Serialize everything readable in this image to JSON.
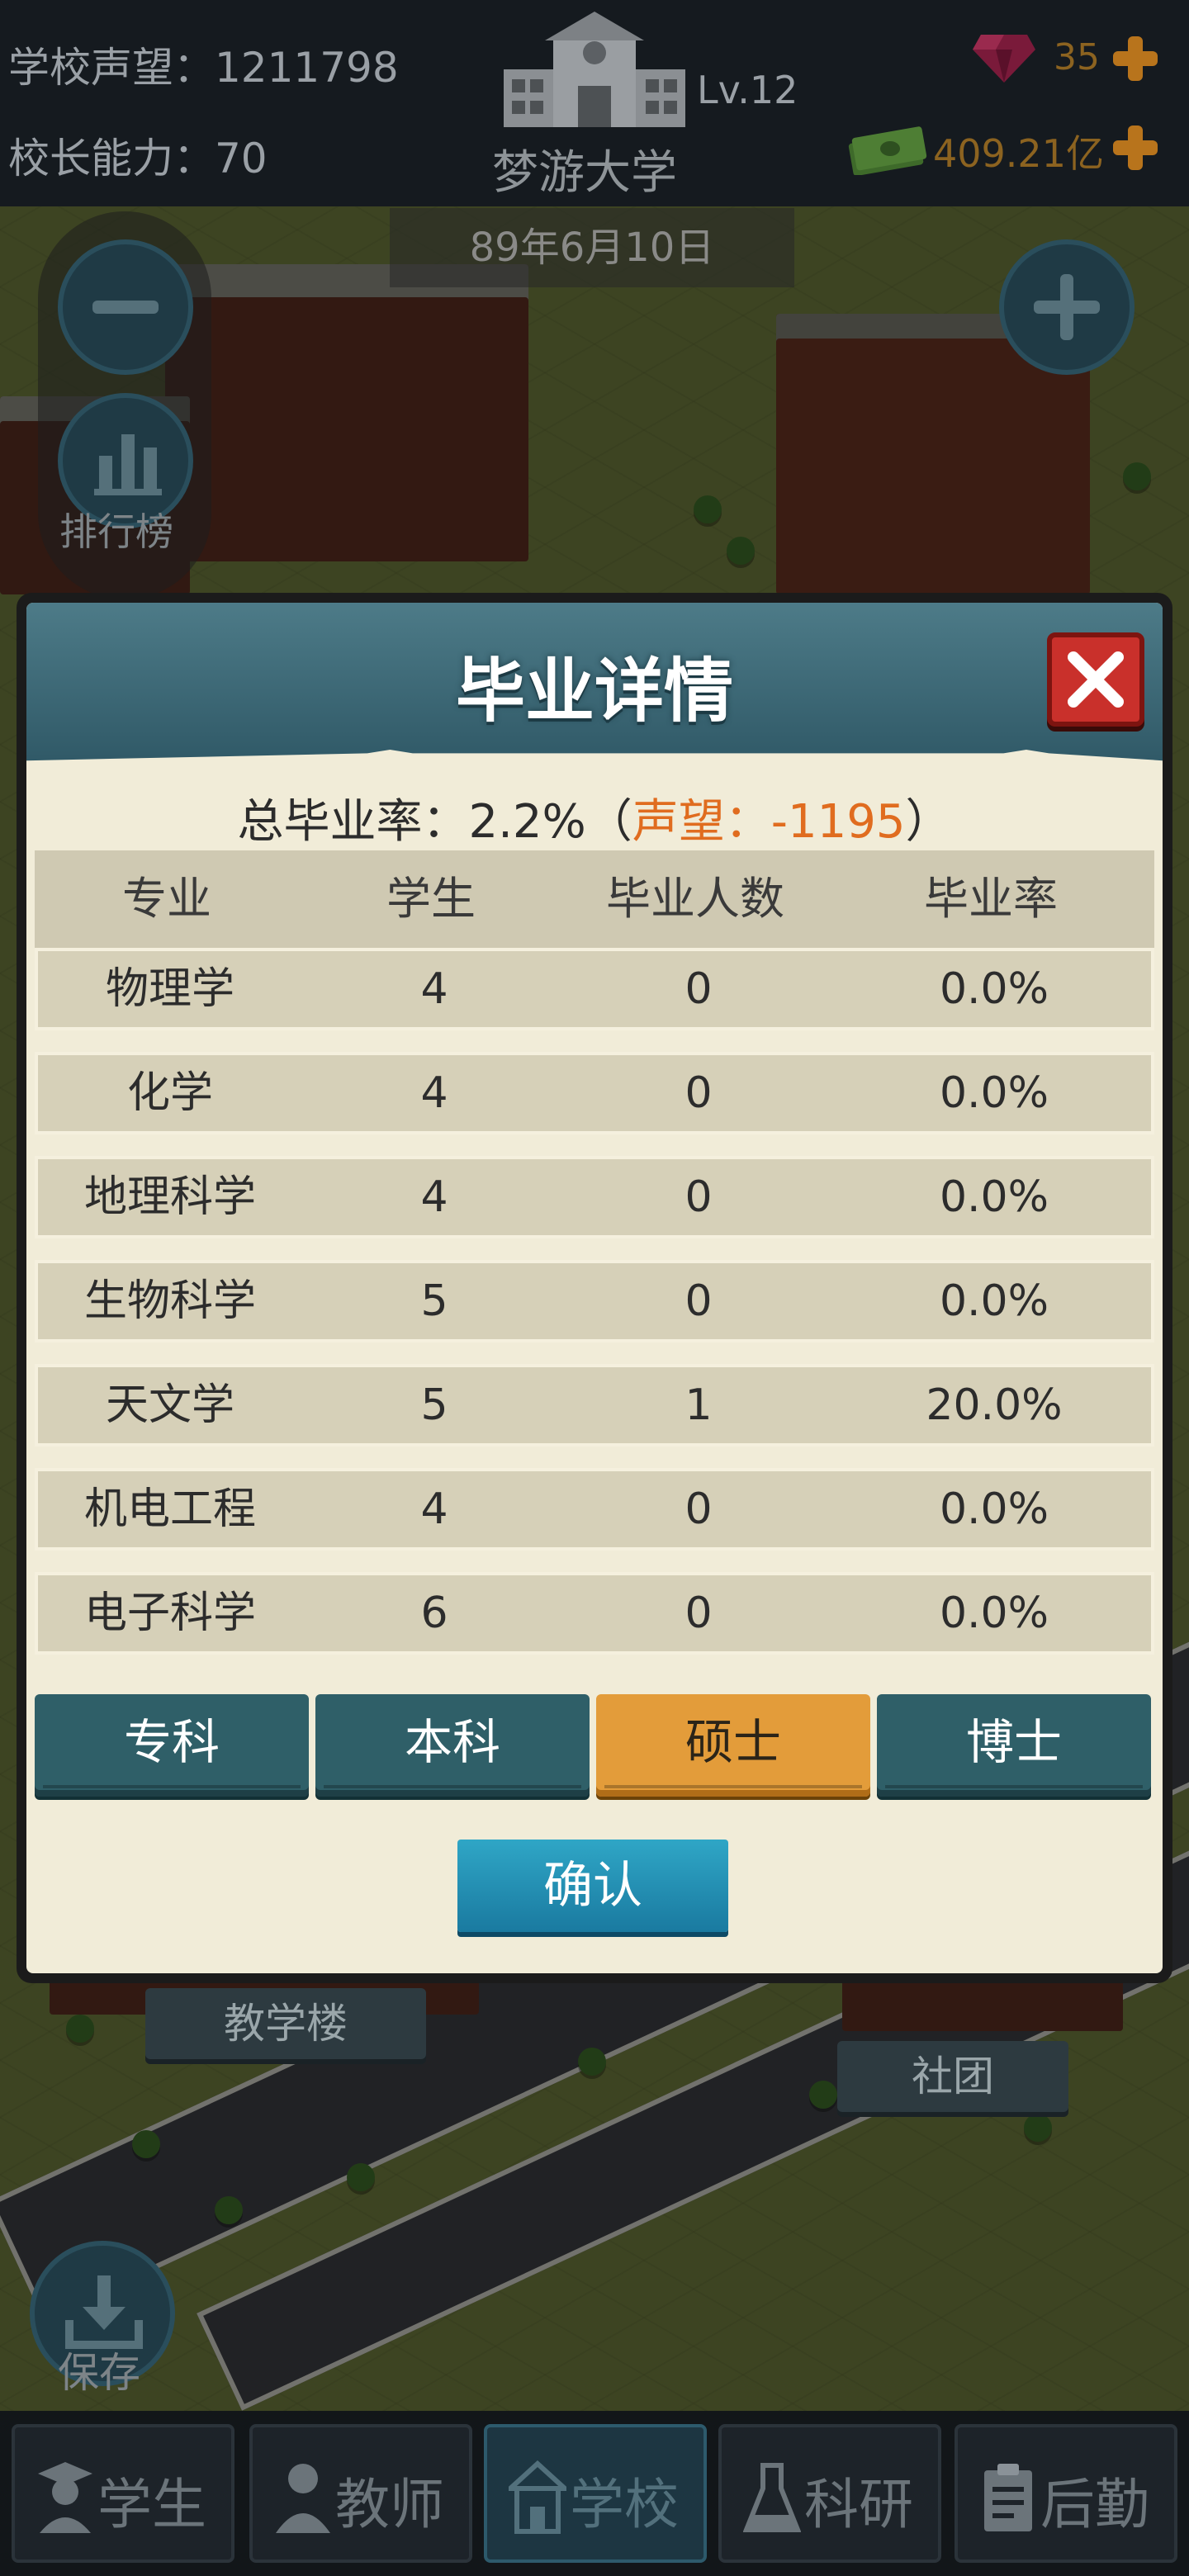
{
  "topbar": {
    "reputation_label": "学校声望：",
    "reputation_value": "1211798",
    "ability_label": "校长能力：",
    "ability_value": "70",
    "school_level": "Lv.12",
    "school_name": "梦游大学",
    "gems": "35",
    "money": "409.21亿",
    "date": "89年6月10日"
  },
  "side": {
    "zoom_out": "−",
    "zoom_in": "+",
    "ranking_label": "排行榜",
    "save_label": "保存"
  },
  "map_labels": {
    "teaching_building": "教学楼",
    "club": "社团"
  },
  "modal": {
    "title": "毕业详情",
    "summary_prefix": "总毕业率：2.2%（",
    "summary_reputation": "声望：-1195",
    "summary_suffix": "）",
    "columns": [
      "专业",
      "学生",
      "毕业人数",
      "毕业率"
    ],
    "rows": [
      {
        "major": "物理学",
        "students": "4",
        "graduates": "0",
        "rate": "0.0%"
      },
      {
        "major": "化学",
        "students": "4",
        "graduates": "0",
        "rate": "0.0%"
      },
      {
        "major": "地理科学",
        "students": "4",
        "graduates": "0",
        "rate": "0.0%"
      },
      {
        "major": "生物科学",
        "students": "5",
        "graduates": "0",
        "rate": "0.0%"
      },
      {
        "major": "天文学",
        "students": "5",
        "graduates": "1",
        "rate": "20.0%"
      },
      {
        "major": "机电工程",
        "students": "4",
        "graduates": "0",
        "rate": "0.0%"
      },
      {
        "major": "电子科学",
        "students": "6",
        "graduates": "0",
        "rate": "0.0%"
      }
    ],
    "tabs": [
      "专科",
      "本科",
      "硕士",
      "博士"
    ],
    "active_tab": "硕士",
    "confirm": "确认"
  },
  "nav": [
    "学生",
    "教师",
    "学校",
    "科研",
    "后勤"
  ],
  "nav_active": "学校",
  "colors": {
    "accent_orange": "#e06c1f",
    "tab_active": "#e39c3a",
    "tab_inactive": "#2f5f68",
    "close_red": "#c9302b",
    "confirm_blue": "#1a7aa0"
  }
}
